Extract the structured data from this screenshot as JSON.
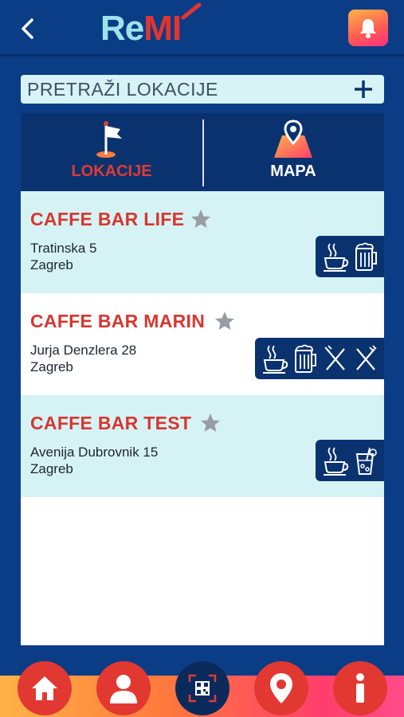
{
  "header": {
    "logo_part1": "Re",
    "logo_part2": "MI",
    "back_icon": "chevron-left-icon",
    "notifications_icon": "bell-icon"
  },
  "search": {
    "placeholder": "PRETRAŽI LOKACIJE",
    "add_icon": "plus-icon"
  },
  "tabs": [
    {
      "label": "LOKACIJE",
      "icon": "flag-pin-icon",
      "active": true
    },
    {
      "label": "MAPA",
      "icon": "map-pin-icon",
      "active": false
    }
  ],
  "locations": [
    {
      "name": "CAFFE BAR LIFE",
      "street": "Tratinska 5",
      "city": "Zagreb",
      "amenities": [
        "coffee-icon",
        "beer-icon"
      ]
    },
    {
      "name": "CAFFE BAR MARIN",
      "street": "Jurja Denzlera 28",
      "city": "Zagreb",
      "amenities": [
        "coffee-icon",
        "beer-icon",
        "cutlery-icon",
        "cutlery-icon"
      ]
    },
    {
      "name": "CAFFE BAR TEST",
      "street": "Avenija Dubrovnik 15",
      "city": "Zagreb",
      "amenities": [
        "coffee-icon",
        "cocktail-icon"
      ]
    }
  ],
  "bottom_nav": [
    {
      "icon": "home-icon"
    },
    {
      "icon": "user-icon"
    },
    {
      "icon": "qr-scan-icon"
    },
    {
      "icon": "location-pin-icon"
    },
    {
      "icon": "info-icon"
    }
  ],
  "colors": {
    "background": "#0b3d86",
    "accent_red": "#e23a35",
    "row_alt": "#d5f3f5",
    "dark_panel": "#0a326f"
  }
}
